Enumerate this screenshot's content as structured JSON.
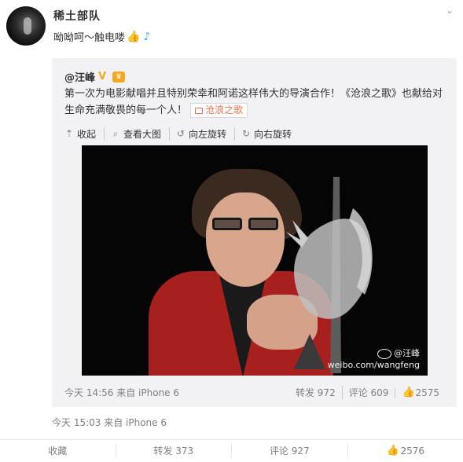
{
  "post": {
    "user_name": "稀土部队",
    "text": "呦呦呵～触电喽",
    "emojis": [
      "thumbs-up",
      "music-note"
    ],
    "time": "今天 15:03 来自 iPhone 6"
  },
  "repost": {
    "author": "@汪峰",
    "text": "第一次为电影献唱并且特别荣幸和阿诺这样伟大的导演合作！《沧浪之歌》也献给对生命充满敬畏的每一个人！",
    "video_label": "沧浪之歌",
    "toolbar": {
      "collapse": "收起",
      "view_large": "查看大图",
      "rotate_left": "向左旋转",
      "rotate_right": "向右旋转"
    },
    "watermark": {
      "handle": "@汪峰",
      "url": "weibo.com/wangfeng"
    },
    "time": "今天 14:56 来自 iPhone 6",
    "stats": {
      "repost": "转发 972",
      "comment": "评论 609",
      "like": "2575"
    }
  },
  "actions": {
    "favorite": "收藏",
    "repost": "转发 373",
    "comment": "评论 927",
    "like": "2576"
  },
  "colors": {
    "accent_link": "#eb7350",
    "repost_bg": "#f2f2f5",
    "verified": "#f3a722"
  }
}
